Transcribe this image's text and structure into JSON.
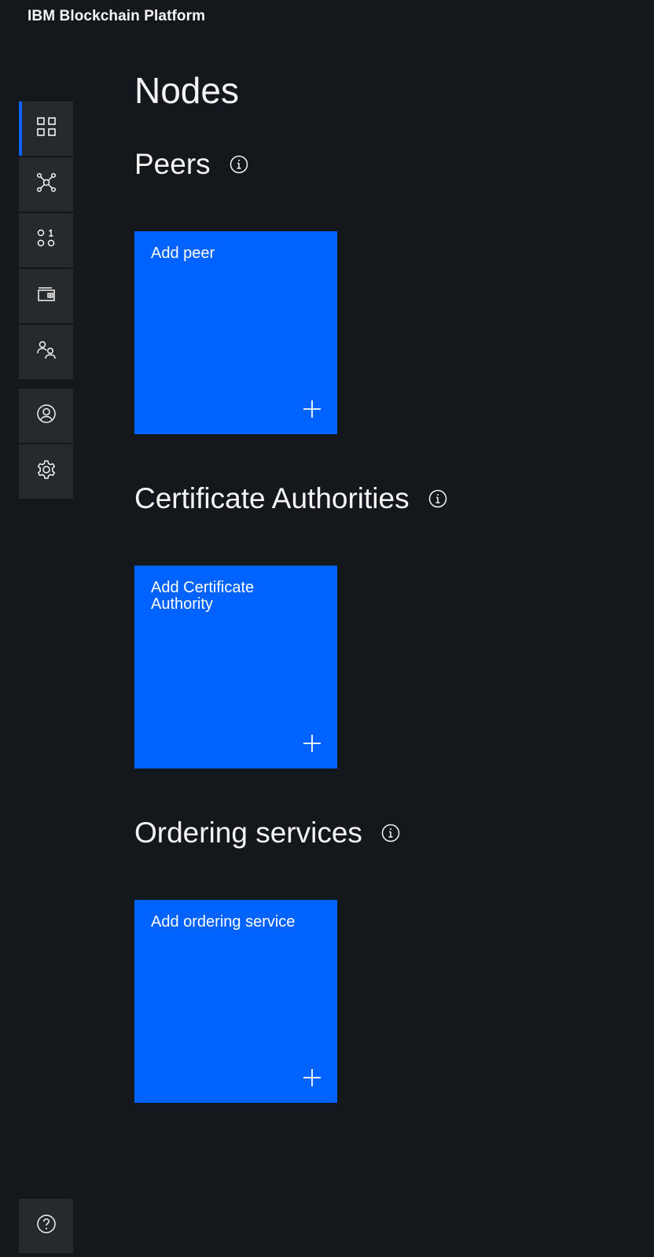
{
  "app": {
    "title": "IBM Blockchain Platform"
  },
  "sidebar": {
    "items": [
      {
        "name": "nodes",
        "icon": "dashboard-grid-icon",
        "active": true
      },
      {
        "name": "channels",
        "icon": "network-icon",
        "active": false
      },
      {
        "name": "smart-contracts",
        "icon": "binary-code-icon",
        "active": false
      },
      {
        "name": "wallet",
        "icon": "wallet-icon",
        "active": false
      },
      {
        "name": "organizations",
        "icon": "user-group-icon",
        "active": false
      },
      {
        "name": "users",
        "icon": "user-avatar-icon",
        "active": false
      },
      {
        "name": "settings",
        "icon": "gear-icon",
        "active": false
      },
      {
        "name": "support",
        "icon": "help-icon",
        "active": false
      }
    ]
  },
  "main": {
    "page_title": "Nodes",
    "sections": [
      {
        "title": "Peers",
        "tile_label": "Add peer"
      },
      {
        "title": "Certificate Authorities",
        "tile_label": "Add Certificate Authority"
      },
      {
        "title": "Ordering services",
        "tile_label": "Add ordering service"
      }
    ]
  },
  "colors": {
    "background": "#14181c",
    "sidebar_button": "#262a2e",
    "accent": "#0f62fe",
    "tile": "#0062ff",
    "text": "#f4f4f4"
  }
}
